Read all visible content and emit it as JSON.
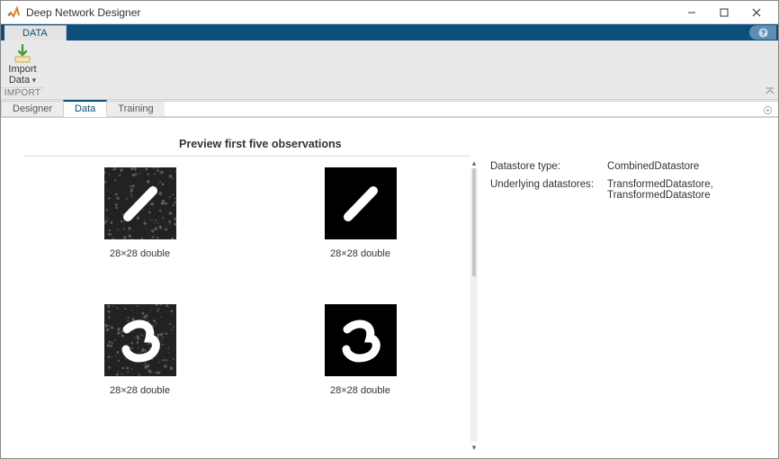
{
  "titlebar": {
    "title": "Deep Network Designer"
  },
  "toolstrip": {
    "tab": "DATA"
  },
  "ribbon": {
    "import": {
      "line1": "Import",
      "line2": "Data"
    },
    "group_label": "IMPORT"
  },
  "subtabs": {
    "designer": "Designer",
    "data": "Data",
    "training": "Training"
  },
  "preview": {
    "heading": "Preview first five observations",
    "items": [
      {
        "caption": "28×28 double",
        "noisy": true,
        "glyph": "one"
      },
      {
        "caption": "28×28 double",
        "noisy": false,
        "glyph": "one"
      },
      {
        "caption": "28×28 double",
        "noisy": true,
        "glyph": "three"
      },
      {
        "caption": "28×28 double",
        "noisy": false,
        "glyph": "three"
      }
    ]
  },
  "info": {
    "datastore_type_label": "Datastore type:",
    "datastore_type_value": "CombinedDatastore",
    "underlying_label": "Underlying datastores:",
    "underlying_value": "TransformedDatastore, TransformedDatastore"
  }
}
